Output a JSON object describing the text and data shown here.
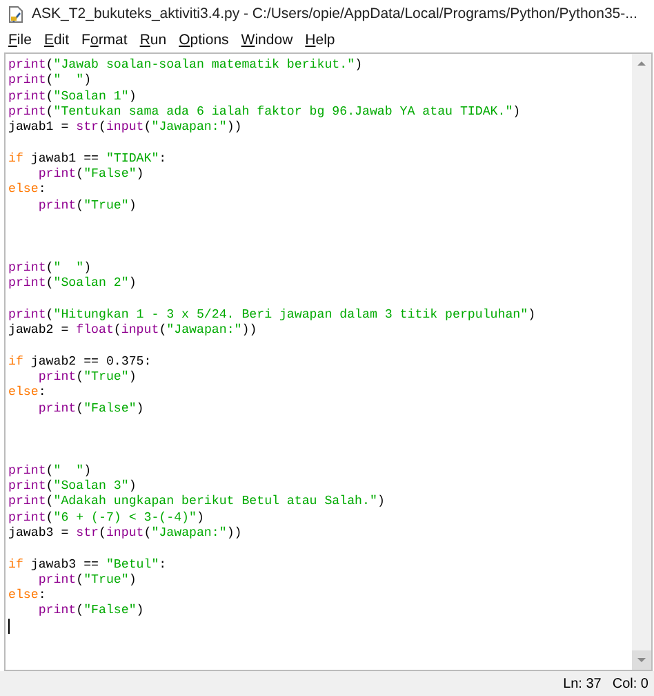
{
  "window": {
    "title": "ASK_T2_bukuteks_aktiviti3.4.py - C:/Users/opie/AppData/Local/Programs/Python/Python35-..."
  },
  "menu": [
    {
      "access_key": "F",
      "rest": "ile"
    },
    {
      "access_key": "E",
      "rest": "dit"
    },
    {
      "lead": "F",
      "access_key": "o",
      "rest": "rmat"
    },
    {
      "access_key": "R",
      "rest": "un"
    },
    {
      "access_key": "O",
      "rest": "ptions"
    },
    {
      "access_key": "W",
      "rest": "indow"
    },
    {
      "access_key": "H",
      "rest": "elp"
    }
  ],
  "editor": {
    "lines": [
      {
        "kind": "code",
        "tokens": [
          {
            "kind": "builtin",
            "text": "print"
          },
          {
            "kind": "plain",
            "text": "("
          },
          {
            "kind": "string",
            "text": "\"Jawab soalan-soalan matematik berikut.\""
          },
          {
            "kind": "plain",
            "text": ")"
          }
        ]
      },
      {
        "kind": "code",
        "tokens": [
          {
            "kind": "builtin",
            "text": "print"
          },
          {
            "kind": "plain",
            "text": "("
          },
          {
            "kind": "string",
            "text": "\"  \""
          },
          {
            "kind": "plain",
            "text": ")"
          }
        ]
      },
      {
        "kind": "code",
        "tokens": [
          {
            "kind": "builtin",
            "text": "print"
          },
          {
            "kind": "plain",
            "text": "("
          },
          {
            "kind": "string",
            "text": "\"Soalan 1\""
          },
          {
            "kind": "plain",
            "text": ")"
          }
        ]
      },
      {
        "kind": "code",
        "tokens": [
          {
            "kind": "builtin",
            "text": "print"
          },
          {
            "kind": "plain",
            "text": "("
          },
          {
            "kind": "string",
            "text": "\"Tentukan sama ada 6 ialah faktor bg 96.Jawab YA atau TIDAK.\""
          },
          {
            "kind": "plain",
            "text": ")"
          }
        ]
      },
      {
        "kind": "code",
        "tokens": [
          {
            "kind": "plain",
            "text": "jawab1 = "
          },
          {
            "kind": "builtin",
            "text": "str"
          },
          {
            "kind": "plain",
            "text": "("
          },
          {
            "kind": "builtin",
            "text": "input"
          },
          {
            "kind": "plain",
            "text": "("
          },
          {
            "kind": "string",
            "text": "\"Jawapan:\""
          },
          {
            "kind": "plain",
            "text": "))"
          }
        ]
      },
      {
        "kind": "blank"
      },
      {
        "kind": "code",
        "tokens": [
          {
            "kind": "keyword",
            "text": "if"
          },
          {
            "kind": "plain",
            "text": " jawab1 == "
          },
          {
            "kind": "string",
            "text": "\"TIDAK\""
          },
          {
            "kind": "plain",
            "text": ":"
          }
        ]
      },
      {
        "kind": "indented",
        "tokens": [
          {
            "kind": "builtin",
            "text": "print"
          },
          {
            "kind": "plain",
            "text": "("
          },
          {
            "kind": "string",
            "text": "\"False\""
          },
          {
            "kind": "plain",
            "text": ")"
          }
        ]
      },
      {
        "kind": "code",
        "tokens": [
          {
            "kind": "keyword",
            "text": "else"
          },
          {
            "kind": "plain",
            "text": ":"
          }
        ]
      },
      {
        "kind": "indented",
        "tokens": [
          {
            "kind": "builtin",
            "text": "print"
          },
          {
            "kind": "plain",
            "text": "("
          },
          {
            "kind": "string",
            "text": "\"True\""
          },
          {
            "kind": "plain",
            "text": ")"
          }
        ]
      },
      {
        "kind": "blank"
      },
      {
        "kind": "blank"
      },
      {
        "kind": "blank"
      },
      {
        "kind": "code",
        "tokens": [
          {
            "kind": "builtin",
            "text": "print"
          },
          {
            "kind": "plain",
            "text": "("
          },
          {
            "kind": "string",
            "text": "\"  \""
          },
          {
            "kind": "plain",
            "text": ")"
          }
        ]
      },
      {
        "kind": "code",
        "tokens": [
          {
            "kind": "builtin",
            "text": "print"
          },
          {
            "kind": "plain",
            "text": "("
          },
          {
            "kind": "string",
            "text": "\"Soalan 2\""
          },
          {
            "kind": "plain",
            "text": ")"
          }
        ]
      },
      {
        "kind": "blank"
      },
      {
        "kind": "code",
        "tokens": [
          {
            "kind": "builtin",
            "text": "print"
          },
          {
            "kind": "plain",
            "text": "("
          },
          {
            "kind": "string",
            "text": "\"Hitungkan 1 - 3 x 5/24. Beri jawapan dalam 3 titik perpuluhan\""
          },
          {
            "kind": "plain",
            "text": ")"
          }
        ]
      },
      {
        "kind": "code",
        "tokens": [
          {
            "kind": "plain",
            "text": "jawab2 = "
          },
          {
            "kind": "builtin",
            "text": "float"
          },
          {
            "kind": "plain",
            "text": "("
          },
          {
            "kind": "builtin",
            "text": "input"
          },
          {
            "kind": "plain",
            "text": "("
          },
          {
            "kind": "string",
            "text": "\"Jawapan:\""
          },
          {
            "kind": "plain",
            "text": "))"
          }
        ]
      },
      {
        "kind": "blank"
      },
      {
        "kind": "code",
        "tokens": [
          {
            "kind": "keyword",
            "text": "if"
          },
          {
            "kind": "plain",
            "text": " jawab2 == 0.375:"
          }
        ]
      },
      {
        "kind": "indented",
        "tokens": [
          {
            "kind": "builtin",
            "text": "print"
          },
          {
            "kind": "plain",
            "text": "("
          },
          {
            "kind": "string",
            "text": "\"True\""
          },
          {
            "kind": "plain",
            "text": ")"
          }
        ]
      },
      {
        "kind": "code",
        "tokens": [
          {
            "kind": "keyword",
            "text": "else"
          },
          {
            "kind": "plain",
            "text": ":"
          }
        ]
      },
      {
        "kind": "indented",
        "tokens": [
          {
            "kind": "builtin",
            "text": "print"
          },
          {
            "kind": "plain",
            "text": "("
          },
          {
            "kind": "string",
            "text": "\"False\""
          },
          {
            "kind": "plain",
            "text": ")"
          }
        ]
      },
      {
        "kind": "blank"
      },
      {
        "kind": "blank"
      },
      {
        "kind": "blank"
      },
      {
        "kind": "code",
        "tokens": [
          {
            "kind": "builtin",
            "text": "print"
          },
          {
            "kind": "plain",
            "text": "("
          },
          {
            "kind": "string",
            "text": "\"  \""
          },
          {
            "kind": "plain",
            "text": ")"
          }
        ]
      },
      {
        "kind": "code",
        "tokens": [
          {
            "kind": "builtin",
            "text": "print"
          },
          {
            "kind": "plain",
            "text": "("
          },
          {
            "kind": "string",
            "text": "\"Soalan 3\""
          },
          {
            "kind": "plain",
            "text": ")"
          }
        ]
      },
      {
        "kind": "code",
        "tokens": [
          {
            "kind": "builtin",
            "text": "print"
          },
          {
            "kind": "plain",
            "text": "("
          },
          {
            "kind": "string",
            "text": "\"Adakah ungkapan berikut Betul atau Salah.\""
          },
          {
            "kind": "plain",
            "text": ")"
          }
        ]
      },
      {
        "kind": "code",
        "tokens": [
          {
            "kind": "builtin",
            "text": "print"
          },
          {
            "kind": "plain",
            "text": "("
          },
          {
            "kind": "string",
            "text": "\"6 + (-7) < 3-(-4)\""
          },
          {
            "kind": "plain",
            "text": ")"
          }
        ]
      },
      {
        "kind": "code",
        "tokens": [
          {
            "kind": "plain",
            "text": "jawab3 = "
          },
          {
            "kind": "builtin",
            "text": "str"
          },
          {
            "kind": "plain",
            "text": "("
          },
          {
            "kind": "builtin",
            "text": "input"
          },
          {
            "kind": "plain",
            "text": "("
          },
          {
            "kind": "string",
            "text": "\"Jawapan:\""
          },
          {
            "kind": "plain",
            "text": "))"
          }
        ]
      },
      {
        "kind": "blank"
      },
      {
        "kind": "code",
        "tokens": [
          {
            "kind": "keyword",
            "text": "if"
          },
          {
            "kind": "plain",
            "text": " jawab3 == "
          },
          {
            "kind": "string",
            "text": "\"Betul\""
          },
          {
            "kind": "plain",
            "text": ":"
          }
        ]
      },
      {
        "kind": "indented",
        "tokens": [
          {
            "kind": "builtin",
            "text": "print"
          },
          {
            "kind": "plain",
            "text": "("
          },
          {
            "kind": "string",
            "text": "\"True\""
          },
          {
            "kind": "plain",
            "text": ")"
          }
        ]
      },
      {
        "kind": "code",
        "tokens": [
          {
            "kind": "keyword",
            "text": "else"
          },
          {
            "kind": "plain",
            "text": ":"
          }
        ]
      },
      {
        "kind": "indented",
        "tokens": [
          {
            "kind": "builtin",
            "text": "print"
          },
          {
            "kind": "plain",
            "text": "("
          },
          {
            "kind": "string",
            "text": "\"False\""
          },
          {
            "kind": "plain",
            "text": ")"
          }
        ]
      },
      {
        "kind": "caret"
      }
    ]
  },
  "status_bar": {
    "line": "Ln: 37",
    "column": "Col: 0"
  }
}
